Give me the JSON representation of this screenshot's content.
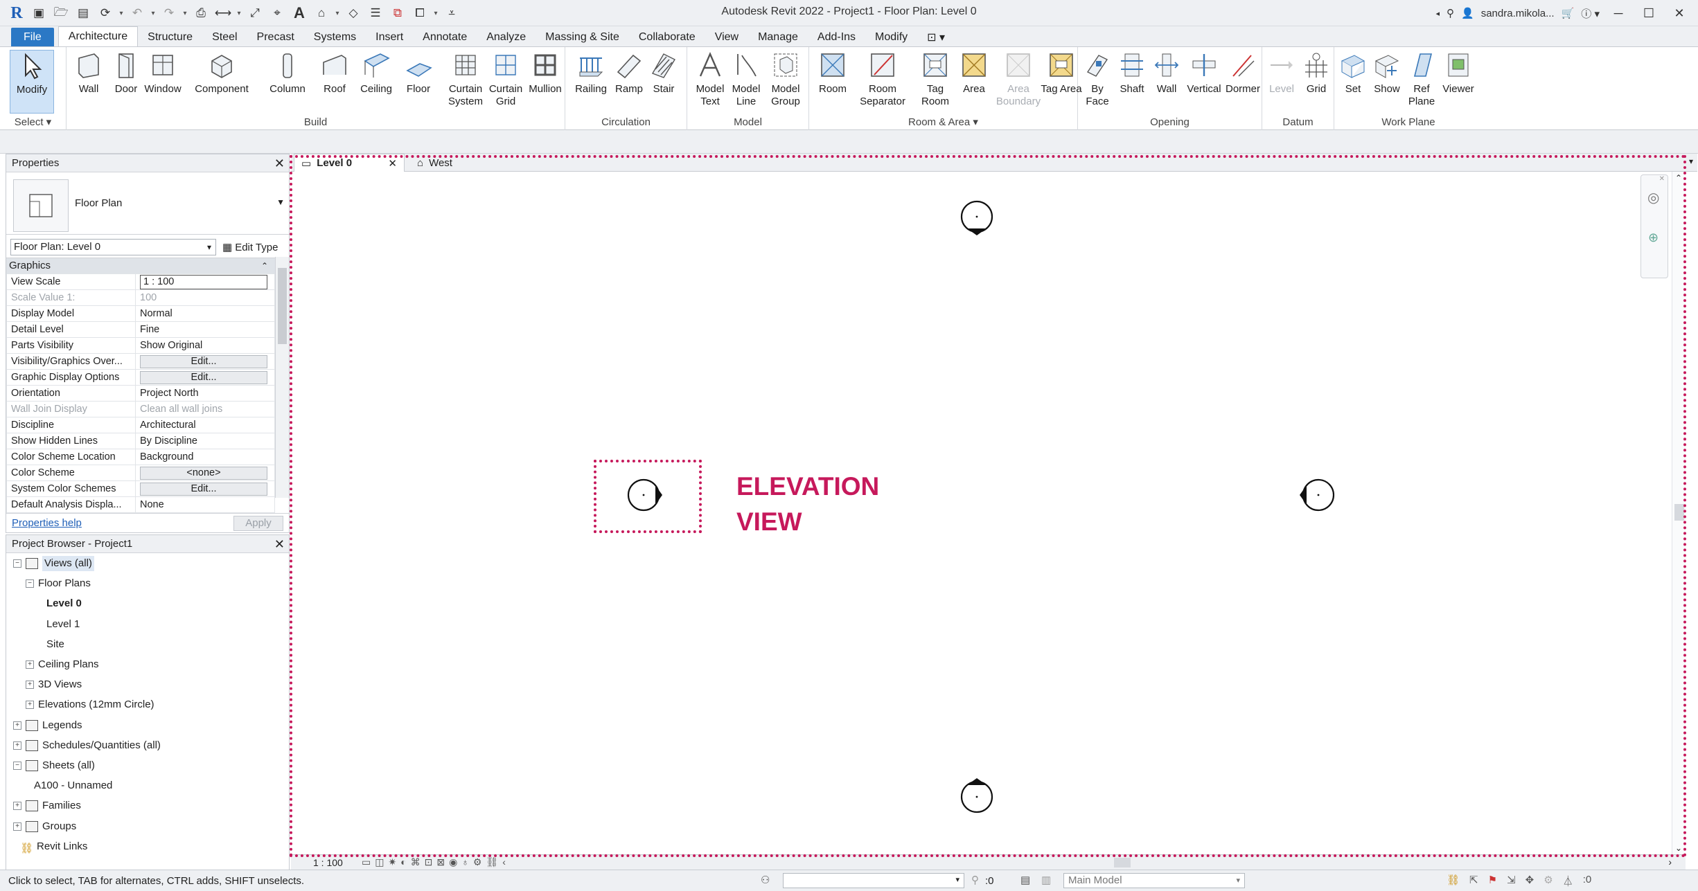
{
  "window": {
    "title": "Autodesk Revit 2022 - Project1 - Floor Plan: Level 0",
    "user": "sandra.mikola...",
    "quick_access": [
      "new-icon",
      "open-icon",
      "save-icon",
      "sync-icon",
      "undo-icon",
      "redo-icon",
      "print-icon",
      "measure-icon",
      "dimension-icon",
      "tag-icon",
      "text-icon",
      "3d-icon",
      "section-icon",
      "thin-lines-icon",
      "close-hidden-icon",
      "switch-windows-icon",
      "customize-icon"
    ]
  },
  "ribbon_tabs": [
    "File",
    "Architecture",
    "Structure",
    "Steel",
    "Precast",
    "Systems",
    "Insert",
    "Annotate",
    "Analyze",
    "Massing & Site",
    "Collaborate",
    "View",
    "Manage",
    "Add-Ins",
    "Modify"
  ],
  "ribbon": {
    "select": {
      "button": "Modify",
      "title": "Select"
    },
    "build": {
      "title": "Build",
      "buttons": [
        "Wall",
        "Door",
        "Window",
        "Component",
        "Column",
        "Roof",
        "Ceiling",
        "Floor",
        "Curtain System",
        "Curtain Grid",
        "Mullion"
      ]
    },
    "circulation": {
      "title": "Circulation",
      "buttons": [
        "Railing",
        "Ramp",
        "Stair"
      ]
    },
    "model": {
      "title": "Model",
      "buttons": [
        "Model Text",
        "Model Line",
        "Model Group"
      ]
    },
    "room_area": {
      "title": "Room & Area",
      "buttons": [
        "Room",
        "Room Separator",
        "Tag Room",
        "Area",
        "Area Boundary",
        "Tag Area"
      ]
    },
    "opening": {
      "title": "Opening",
      "buttons": [
        "By Face",
        "Shaft",
        "Wall",
        "Vertical",
        "Dormer"
      ]
    },
    "datum": {
      "title": "Datum",
      "buttons": [
        "Level",
        "Grid"
      ]
    },
    "work_plane": {
      "title": "Work Plane",
      "buttons": [
        "Set",
        "Show",
        "Ref Plane",
        "Viewer"
      ]
    }
  },
  "properties": {
    "title": "Properties",
    "type_name": "Floor Plan",
    "instance": "Floor Plan: Level 0",
    "edit_type": "Edit Type",
    "group": "Graphics",
    "rows": [
      {
        "name": "View Scale",
        "value": "1 : 100"
      },
      {
        "name": "Scale Value    1:",
        "value": "100"
      },
      {
        "name": "Display Model",
        "value": "Normal"
      },
      {
        "name": "Detail Level",
        "value": "Fine"
      },
      {
        "name": "Parts Visibility",
        "value": "Show Original"
      },
      {
        "name": "Visibility/Graphics Over...",
        "value": "Edit..."
      },
      {
        "name": "Graphic Display Options",
        "value": "Edit..."
      },
      {
        "name": "Orientation",
        "value": "Project North"
      },
      {
        "name": "Wall Join Display",
        "value": "Clean all wall joins"
      },
      {
        "name": "Discipline",
        "value": "Architectural"
      },
      {
        "name": "Show Hidden Lines",
        "value": "By Discipline"
      },
      {
        "name": "Color Scheme Location",
        "value": "Background"
      },
      {
        "name": "Color Scheme",
        "value": "<none>"
      },
      {
        "name": "System Color Schemes",
        "value": "Edit..."
      },
      {
        "name": "Default Analysis Displa...",
        "value": "None"
      }
    ],
    "help": "Properties help",
    "apply": "Apply"
  },
  "browser": {
    "title": "Project Browser - Project1",
    "items": [
      "Views (all)",
      "Floor Plans",
      "Level 0",
      "Level 1",
      "Site",
      "Ceiling Plans",
      "3D Views",
      "Elevations (12mm Circle)",
      "Legends",
      "Schedules/Quantities (all)",
      "Sheets (all)",
      "A100 - Unnamed",
      "Families",
      "Groups",
      "Revit Links"
    ]
  },
  "view_tabs": [
    "Level 0",
    "West"
  ],
  "annotation": {
    "line1": "ELEVATION",
    "line2": "VIEW"
  },
  "view_status": {
    "scale": "1 : 100"
  },
  "statusbar": {
    "message": "Click to select, TAB for alternates, CTRL adds, SHIFT unselects.",
    "selection_count": ":0",
    "model": "Main Model",
    "filter_count": ":0"
  },
  "colors": {
    "accent": "#c6195b",
    "file_tab": "#2b78c5",
    "link": "#1f5fb7"
  }
}
